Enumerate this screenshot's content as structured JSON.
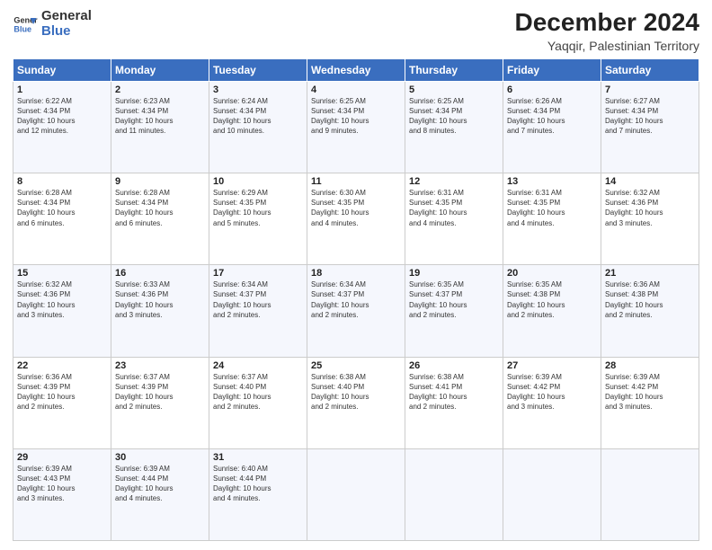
{
  "header": {
    "logo_line1": "General",
    "logo_line2": "Blue",
    "month": "December 2024",
    "location": "Yaqqir, Palestinian Territory"
  },
  "weekdays": [
    "Sunday",
    "Monday",
    "Tuesday",
    "Wednesday",
    "Thursday",
    "Friday",
    "Saturday"
  ],
  "weeks": [
    [
      {
        "day": "1",
        "info": "Sunrise: 6:22 AM\nSunset: 4:34 PM\nDaylight: 10 hours\nand 12 minutes."
      },
      {
        "day": "2",
        "info": "Sunrise: 6:23 AM\nSunset: 4:34 PM\nDaylight: 10 hours\nand 11 minutes."
      },
      {
        "day": "3",
        "info": "Sunrise: 6:24 AM\nSunset: 4:34 PM\nDaylight: 10 hours\nand 10 minutes."
      },
      {
        "day": "4",
        "info": "Sunrise: 6:25 AM\nSunset: 4:34 PM\nDaylight: 10 hours\nand 9 minutes."
      },
      {
        "day": "5",
        "info": "Sunrise: 6:25 AM\nSunset: 4:34 PM\nDaylight: 10 hours\nand 8 minutes."
      },
      {
        "day": "6",
        "info": "Sunrise: 6:26 AM\nSunset: 4:34 PM\nDaylight: 10 hours\nand 7 minutes."
      },
      {
        "day": "7",
        "info": "Sunrise: 6:27 AM\nSunset: 4:34 PM\nDaylight: 10 hours\nand 7 minutes."
      }
    ],
    [
      {
        "day": "8",
        "info": "Sunrise: 6:28 AM\nSunset: 4:34 PM\nDaylight: 10 hours\nand 6 minutes."
      },
      {
        "day": "9",
        "info": "Sunrise: 6:28 AM\nSunset: 4:34 PM\nDaylight: 10 hours\nand 6 minutes."
      },
      {
        "day": "10",
        "info": "Sunrise: 6:29 AM\nSunset: 4:35 PM\nDaylight: 10 hours\nand 5 minutes."
      },
      {
        "day": "11",
        "info": "Sunrise: 6:30 AM\nSunset: 4:35 PM\nDaylight: 10 hours\nand 4 minutes."
      },
      {
        "day": "12",
        "info": "Sunrise: 6:31 AM\nSunset: 4:35 PM\nDaylight: 10 hours\nand 4 minutes."
      },
      {
        "day": "13",
        "info": "Sunrise: 6:31 AM\nSunset: 4:35 PM\nDaylight: 10 hours\nand 4 minutes."
      },
      {
        "day": "14",
        "info": "Sunrise: 6:32 AM\nSunset: 4:36 PM\nDaylight: 10 hours\nand 3 minutes."
      }
    ],
    [
      {
        "day": "15",
        "info": "Sunrise: 6:32 AM\nSunset: 4:36 PM\nDaylight: 10 hours\nand 3 minutes."
      },
      {
        "day": "16",
        "info": "Sunrise: 6:33 AM\nSunset: 4:36 PM\nDaylight: 10 hours\nand 3 minutes."
      },
      {
        "day": "17",
        "info": "Sunrise: 6:34 AM\nSunset: 4:37 PM\nDaylight: 10 hours\nand 2 minutes."
      },
      {
        "day": "18",
        "info": "Sunrise: 6:34 AM\nSunset: 4:37 PM\nDaylight: 10 hours\nand 2 minutes."
      },
      {
        "day": "19",
        "info": "Sunrise: 6:35 AM\nSunset: 4:37 PM\nDaylight: 10 hours\nand 2 minutes."
      },
      {
        "day": "20",
        "info": "Sunrise: 6:35 AM\nSunset: 4:38 PM\nDaylight: 10 hours\nand 2 minutes."
      },
      {
        "day": "21",
        "info": "Sunrise: 6:36 AM\nSunset: 4:38 PM\nDaylight: 10 hours\nand 2 minutes."
      }
    ],
    [
      {
        "day": "22",
        "info": "Sunrise: 6:36 AM\nSunset: 4:39 PM\nDaylight: 10 hours\nand 2 minutes."
      },
      {
        "day": "23",
        "info": "Sunrise: 6:37 AM\nSunset: 4:39 PM\nDaylight: 10 hours\nand 2 minutes."
      },
      {
        "day": "24",
        "info": "Sunrise: 6:37 AM\nSunset: 4:40 PM\nDaylight: 10 hours\nand 2 minutes."
      },
      {
        "day": "25",
        "info": "Sunrise: 6:38 AM\nSunset: 4:40 PM\nDaylight: 10 hours\nand 2 minutes."
      },
      {
        "day": "26",
        "info": "Sunrise: 6:38 AM\nSunset: 4:41 PM\nDaylight: 10 hours\nand 2 minutes."
      },
      {
        "day": "27",
        "info": "Sunrise: 6:39 AM\nSunset: 4:42 PM\nDaylight: 10 hours\nand 3 minutes."
      },
      {
        "day": "28",
        "info": "Sunrise: 6:39 AM\nSunset: 4:42 PM\nDaylight: 10 hours\nand 3 minutes."
      }
    ],
    [
      {
        "day": "29",
        "info": "Sunrise: 6:39 AM\nSunset: 4:43 PM\nDaylight: 10 hours\nand 3 minutes."
      },
      {
        "day": "30",
        "info": "Sunrise: 6:39 AM\nSunset: 4:44 PM\nDaylight: 10 hours\nand 4 minutes."
      },
      {
        "day": "31",
        "info": "Sunrise: 6:40 AM\nSunset: 4:44 PM\nDaylight: 10 hours\nand 4 minutes."
      },
      {
        "day": "",
        "info": ""
      },
      {
        "day": "",
        "info": ""
      },
      {
        "day": "",
        "info": ""
      },
      {
        "day": "",
        "info": ""
      }
    ]
  ]
}
